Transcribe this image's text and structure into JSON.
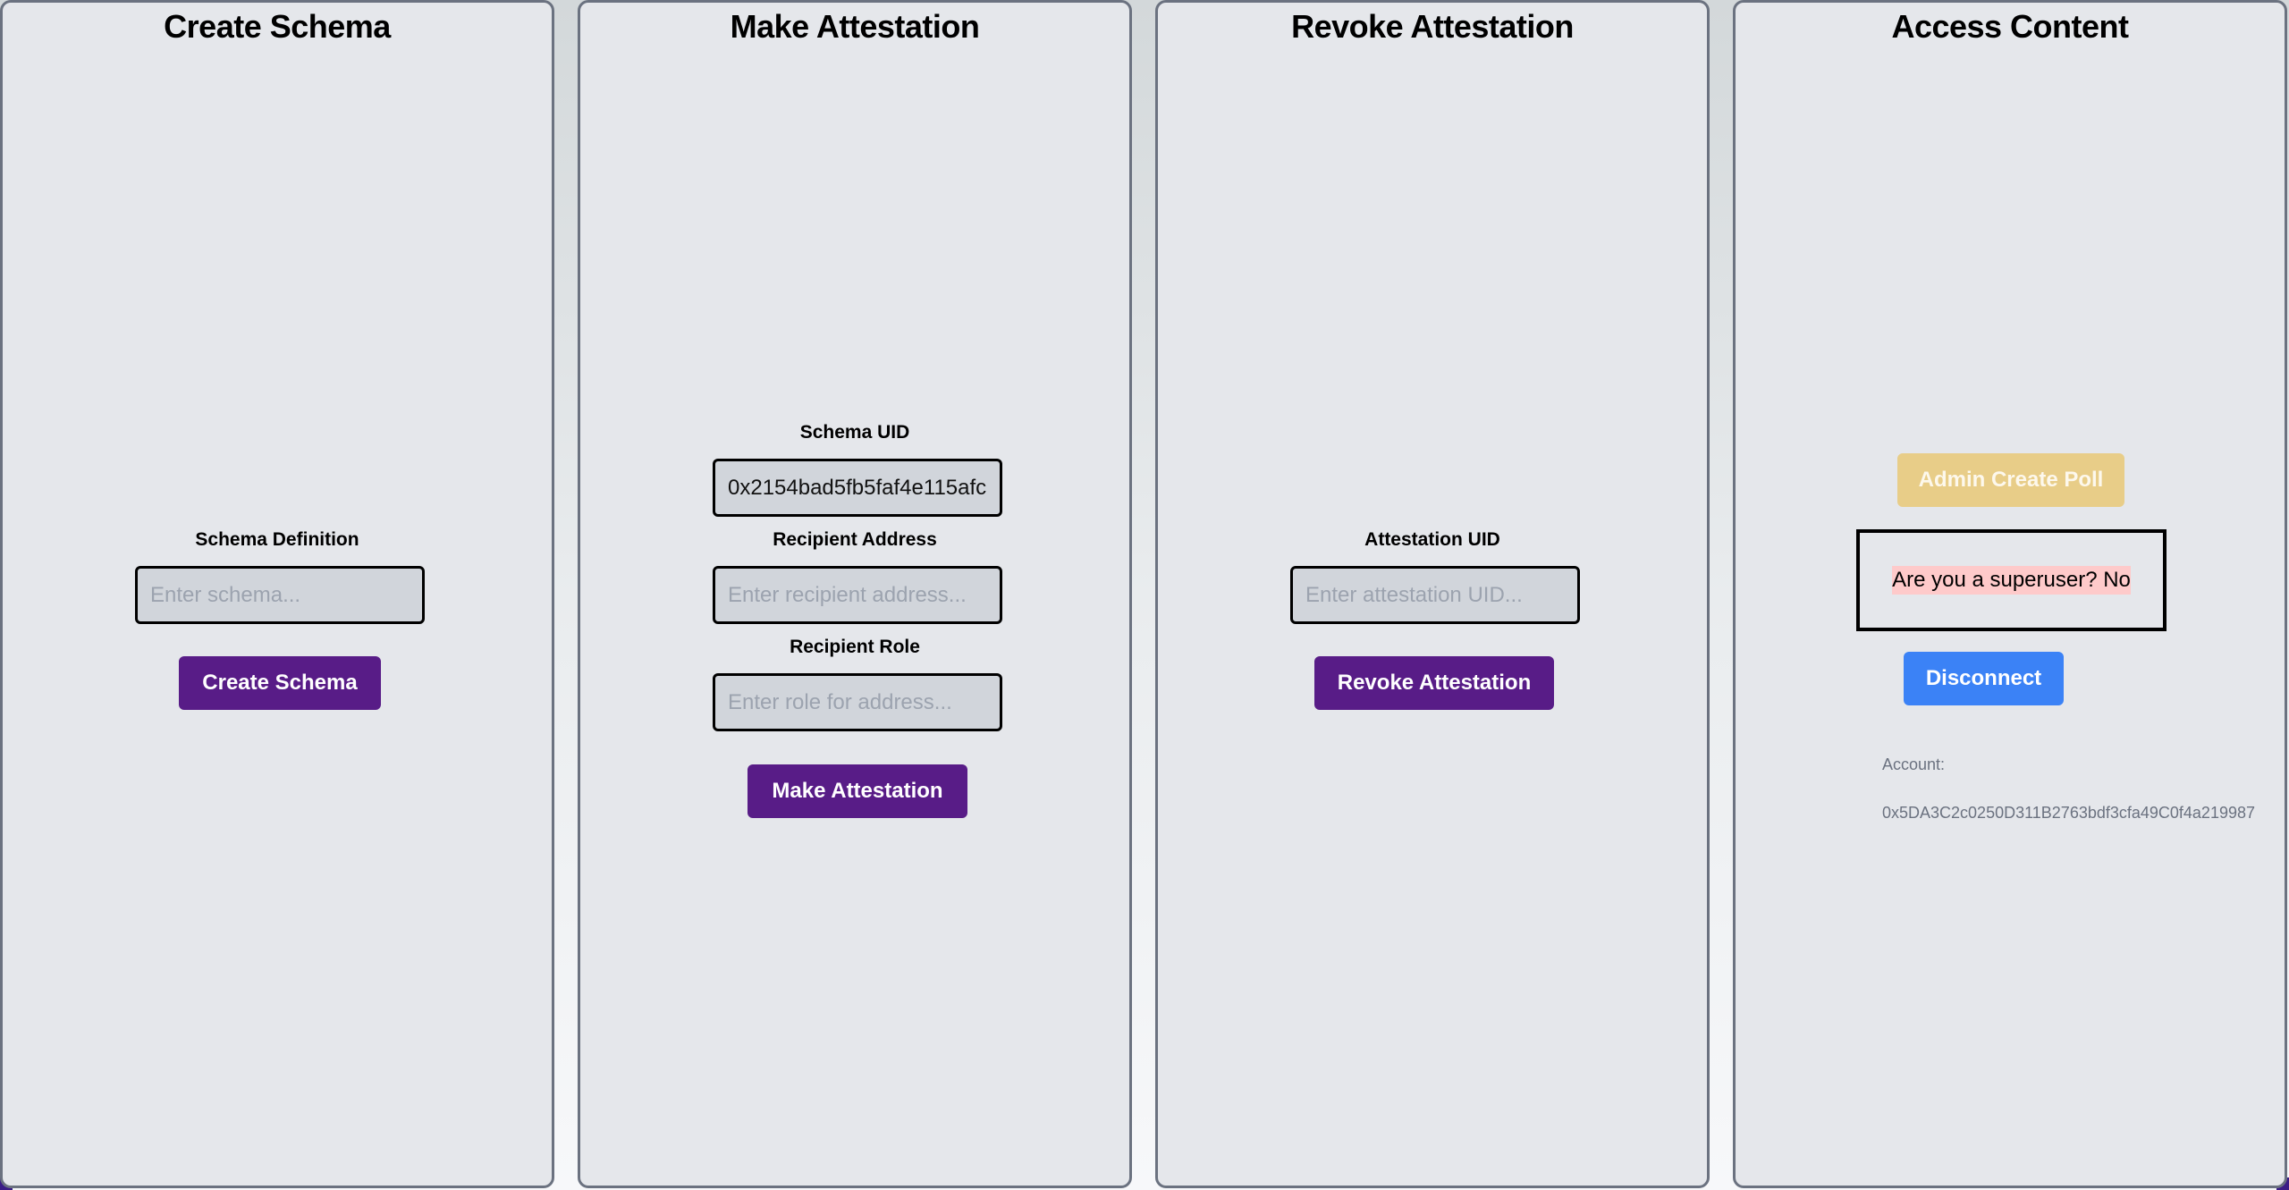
{
  "colors": {
    "panel_background": "#e5e7eb",
    "panel_border": "#6b7280",
    "primary_purple": "#581c87",
    "admin_gold_disabled": "#e8cd88",
    "disconnect_blue": "#3b82f6",
    "superuser_highlight": "#fecaca"
  },
  "panels": {
    "create_schema": {
      "title": "Create Schema",
      "schema_definition": {
        "label": "Schema Definition",
        "value": "",
        "placeholder": "Enter schema..."
      },
      "submit_label": "Create Schema"
    },
    "make_attestation": {
      "title": "Make Attestation",
      "schema_uid": {
        "label": "Schema UID",
        "value": "0x2154bad5fb5faf4e115afc",
        "placeholder": ""
      },
      "recipient_address": {
        "label": "Recipient Address",
        "value": "",
        "placeholder": "Enter recipient address..."
      },
      "recipient_role": {
        "label": "Recipient Role",
        "value": "",
        "placeholder": "Enter role for address..."
      },
      "submit_label": "Make Attestation"
    },
    "revoke_attestation": {
      "title": "Revoke Attestation",
      "attestation_uid": {
        "label": "Attestation UID",
        "value": "",
        "placeholder": "Enter attestation UID..."
      },
      "submit_label": "Revoke Attestation"
    },
    "access_content": {
      "title": "Access Content",
      "admin_button_label": "Admin Create Poll",
      "superuser_status": "Are you a superuser? No",
      "disconnect_label": "Disconnect",
      "account_label": "Account:",
      "account_address": "0x5DA3C2c0250D311B2763bdf3cfa49C0f4a219987"
    }
  }
}
